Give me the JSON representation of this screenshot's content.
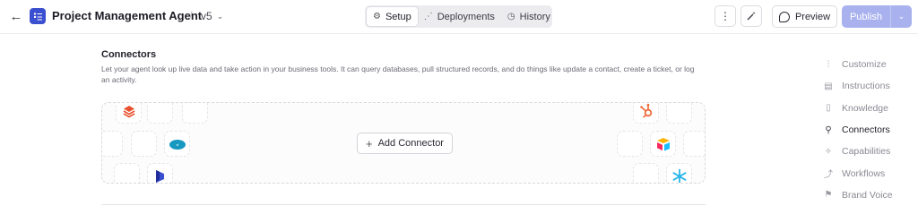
{
  "header": {
    "back_icon": "arrow-left-icon",
    "app_icon": "agent-icon",
    "title": "Project Management Agent",
    "separator": "/",
    "version": "v5",
    "tabs": [
      {
        "label": "Setup",
        "icon": "gear-icon",
        "active": true
      },
      {
        "label": "Deployments",
        "icon": "share-icon",
        "active": false
      },
      {
        "label": "History",
        "icon": "clock-icon",
        "active": false
      }
    ],
    "more_icon": "more-vertical-icon",
    "magic_icon": "magic-wand-icon",
    "preview_label": "Preview",
    "publish_label": "Publish",
    "accent_color": "#3b4fd1",
    "publish_color": "#a9b2ee"
  },
  "connectors": {
    "title": "Connectors",
    "description": "Let your agent look up live data and take action in your business tools. It can query databases, pull structured records, and do things like update a contact, create a ticket, or log an activity.",
    "add_label": "Add Connector",
    "logos": [
      "databricks-logo",
      "salesforce-logo",
      "dynamics-logo",
      "hubspot-logo",
      "airtable-logo",
      "snowflake-logo"
    ]
  },
  "nav": {
    "items": [
      {
        "label": "Customize",
        "icon": "sliders-icon",
        "active": false
      },
      {
        "label": "Instructions",
        "icon": "document-icon",
        "active": false
      },
      {
        "label": "Knowledge",
        "icon": "book-icon",
        "active": false
      },
      {
        "label": "Connectors",
        "icon": "plug-icon",
        "active": true
      },
      {
        "label": "Capabilities",
        "icon": "sparkle-icon",
        "active": false
      },
      {
        "label": "Workflows",
        "icon": "workflow-icon",
        "active": false
      },
      {
        "label": "Brand Voice",
        "icon": "flag-icon",
        "active": false
      }
    ]
  }
}
